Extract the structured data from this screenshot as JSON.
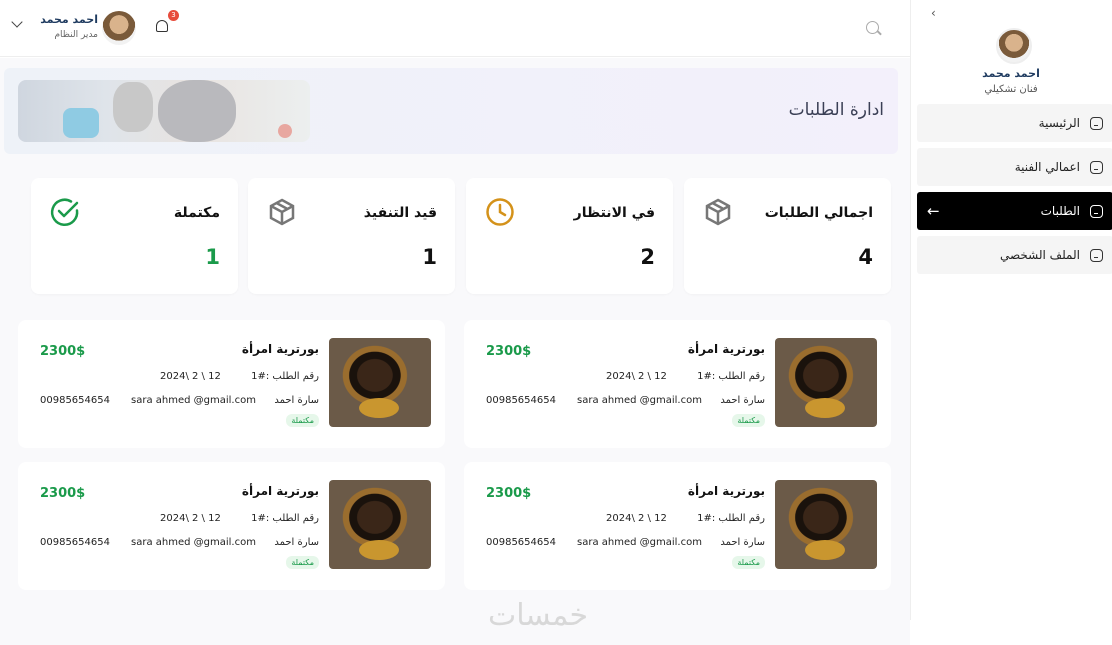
{
  "sidebar": {
    "user_name": "احمد محمد",
    "user_role": "فنان تشكيلي",
    "items": [
      {
        "label": "الرئيسية"
      },
      {
        "label": "اعمالي الفنية"
      },
      {
        "label": "الطلبات"
      },
      {
        "label": "الملف الشخصي"
      }
    ]
  },
  "header": {
    "user_name": "احمد محمد",
    "user_role": "مدير النظام",
    "notifications": "3"
  },
  "page": {
    "title": "ادارة الطلبات",
    "watermark": "خمسات"
  },
  "stats": [
    {
      "label": "اجمالي الطلبات",
      "value": "4"
    },
    {
      "label": "في الانتظار",
      "value": "2"
    },
    {
      "label": "قيد التنفيذ",
      "value": "1"
    },
    {
      "label": "مكتملة",
      "value": "1"
    }
  ],
  "orders": [
    {
      "title": "بورترية امرأة",
      "price": "2300$",
      "order_no": "رقم الطلب :#1",
      "date": "2024\\ 2 \\ 12",
      "customer": "سارة احمد",
      "email": "sara ahmed @gmail.com",
      "phone": "00985654654",
      "status": "مكتملة"
    },
    {
      "title": "بورترية امرأة",
      "price": "2300$",
      "order_no": "رقم الطلب :#1",
      "date": "2024\\ 2 \\ 12",
      "customer": "سارة احمد",
      "email": "sara ahmed @gmail.com",
      "phone": "00985654654",
      "status": "مكتملة"
    },
    {
      "title": "بورترية امرأة",
      "price": "2300$",
      "order_no": "رقم الطلب :#1",
      "date": "2024\\ 2 \\ 12",
      "customer": "سارة احمد",
      "email": "sara ahmed @gmail.com",
      "phone": "00985654654",
      "status": "مكتملة"
    },
    {
      "title": "بورترية امرأة",
      "price": "2300$",
      "order_no": "رقم الطلب :#1",
      "date": "2024\\ 2 \\ 12",
      "customer": "سارة احمد",
      "email": "sara ahmed @gmail.com",
      "phone": "00985654654",
      "status": "مكتملة"
    }
  ],
  "colors": {
    "accent": "#000000",
    "success": "#1a9a4a",
    "pending": "#d4921a"
  }
}
